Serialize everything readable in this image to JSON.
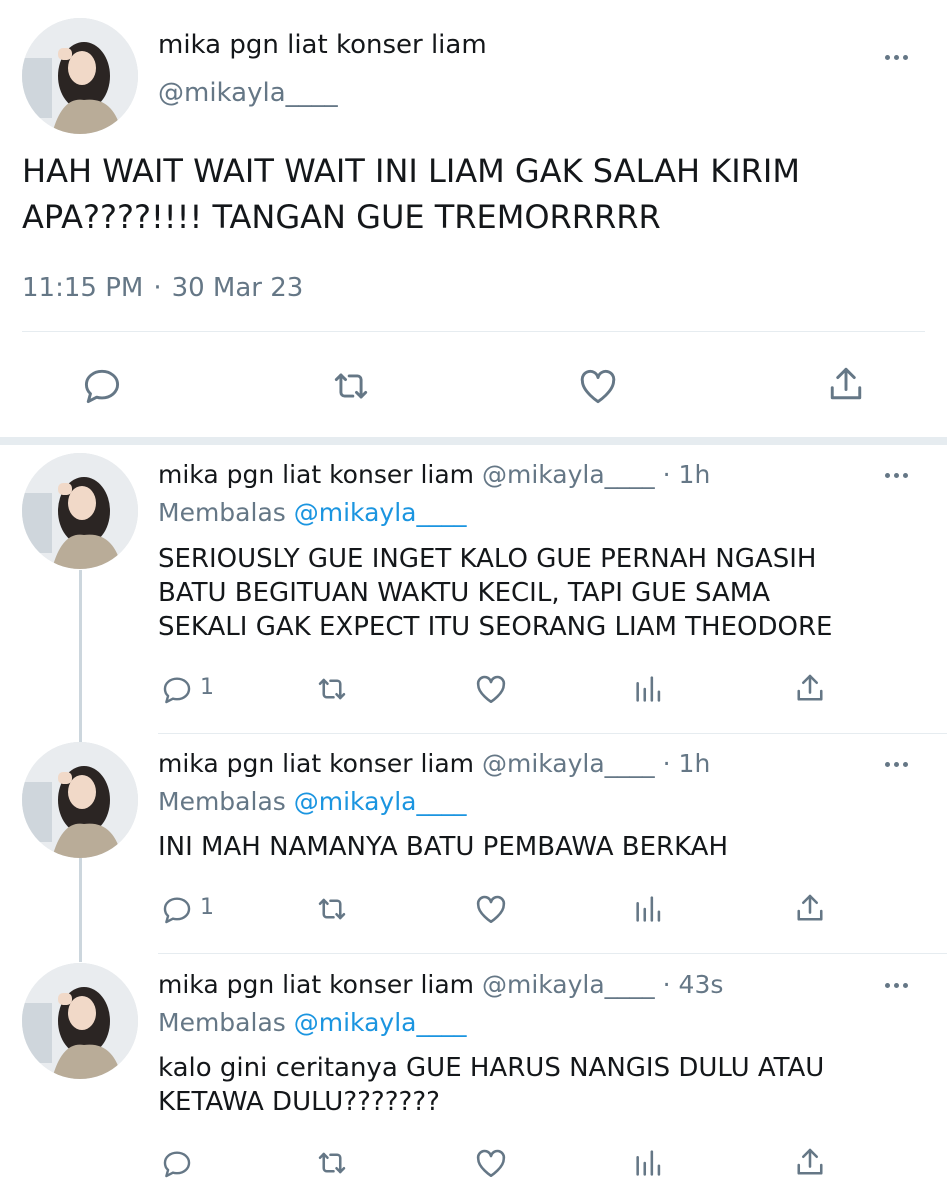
{
  "main_tweet": {
    "display_name": "mika pgn liat konser liam",
    "handle": "@mikayla____",
    "text_line1": "HAH WAIT WAIT WAIT INI LIAM GAK SALAH KIRIM",
    "text_line2": "APA????!!!! TANGAN GUE TREMORRRRR",
    "time": "11:15 PM",
    "date_sep": "·",
    "date": "30 Mar 23"
  },
  "replies": [
    {
      "display_name": "mika pgn liat konser liam",
      "handle": "@mikayla____",
      "time_sep": "·",
      "time": "1h",
      "replying_label": "Membalas",
      "replying_to": "@mikayla____",
      "lines": [
        "SERIOUSLY GUE INGET KALO GUE PERNAH NGASIH",
        "BATU BEGITUAN WAKTU KECIL, TAPI GUE SAMA",
        "SEKALI GAK EXPECT ITU SEORANG LIAM THEODORE"
      ],
      "reply_count": "1"
    },
    {
      "display_name": "mika pgn liat konser liam",
      "handle": "@mikayla____",
      "time_sep": "·",
      "time": "1h",
      "replying_label": "Membalas",
      "replying_to": "@mikayla____",
      "lines": [
        "INI MAH NAMANYA BATU PEMBAWA BERKAH"
      ],
      "reply_count": "1"
    },
    {
      "display_name": "mika pgn liat konser liam",
      "handle": "@mikayla____",
      "time_sep": "·",
      "time": "43s",
      "replying_label": "Membalas",
      "replying_to": "@mikayla____",
      "lines": [
        "kalo gini ceritanya GUE HARUS NANGIS DULU ATAU",
        "KETAWA DULU???????"
      ],
      "reply_count": ""
    }
  ],
  "icons": {
    "reply": "reply-icon",
    "retweet": "retweet-icon",
    "like": "like-icon",
    "share": "share-icon",
    "analytics": "analytics-icon",
    "more": "more-icon"
  },
  "colors": {
    "text": "#14171a",
    "muted": "#657786",
    "link": "#1b95e0",
    "divider": "#e6ecf0",
    "thread_line": "#ccd6dd"
  }
}
